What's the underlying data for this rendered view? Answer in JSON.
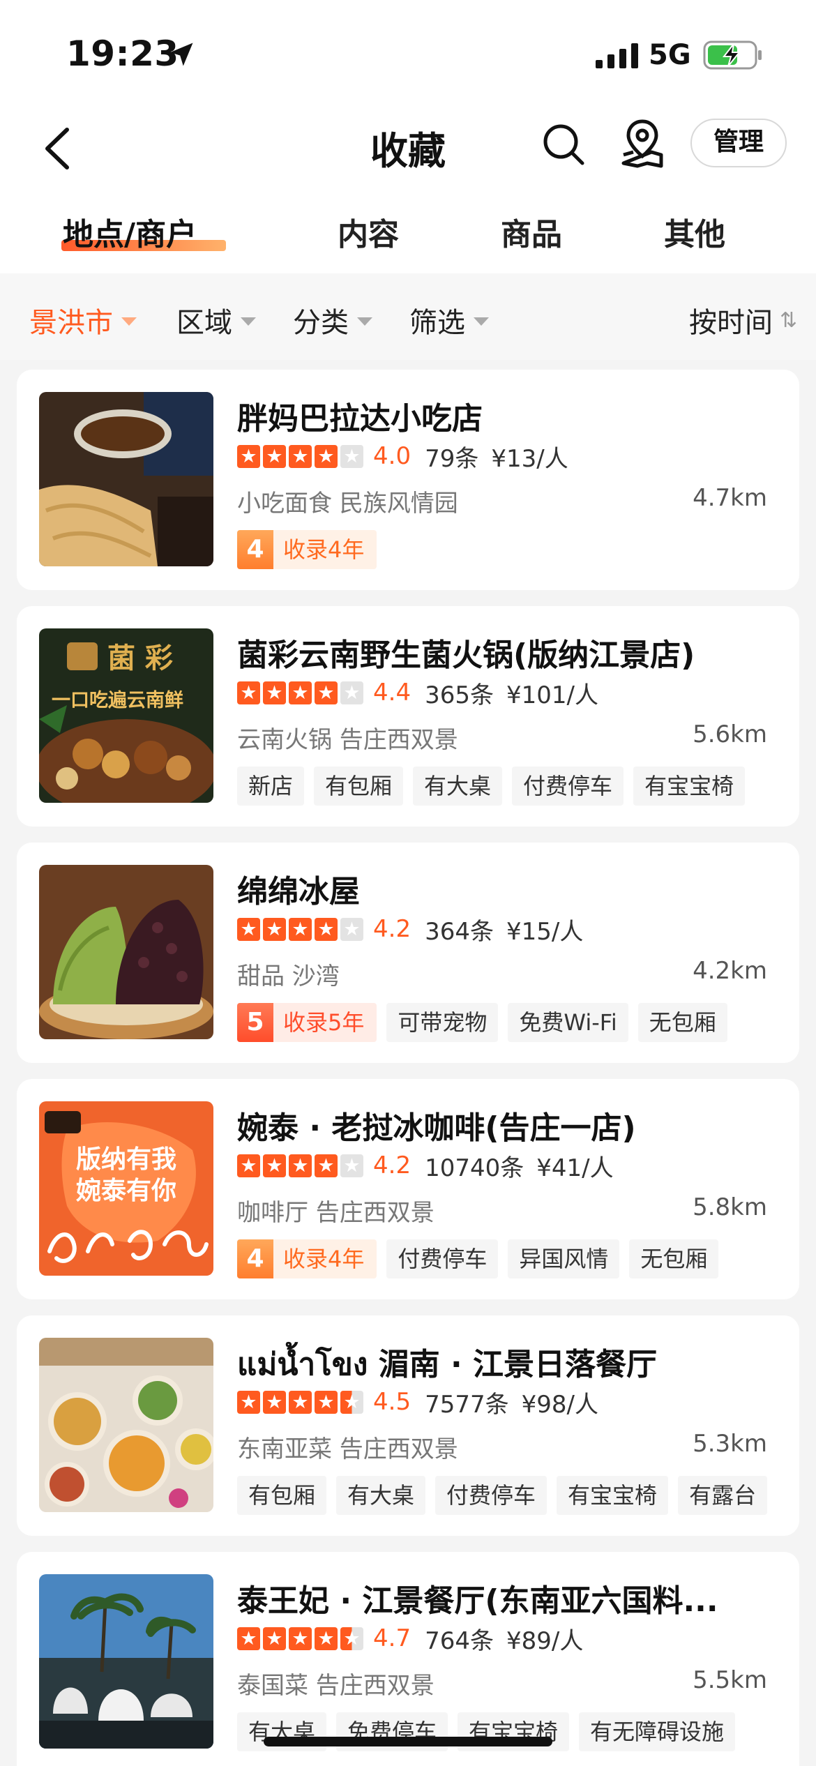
{
  "status": {
    "time": "19:23",
    "network": "5G"
  },
  "nav": {
    "title": "收藏",
    "manage": "管理"
  },
  "tabs": [
    "地点/商户",
    "内容",
    "商品",
    "其他"
  ],
  "filters": {
    "city": "景洪市",
    "area": "区域",
    "category": "分类",
    "filter": "筛选",
    "sort": "按时间"
  },
  "items": [
    {
      "name": "胖妈巴拉达小吃店",
      "stars": 4.0,
      "score": "4.0",
      "reviews": "79条",
      "price": "¥13/人",
      "meta": "小吃面食 民族风情园",
      "distance": "4.7km",
      "record": {
        "num": "4",
        "text": "收录4年"
      },
      "tags": []
    },
    {
      "name": "菌彩云南野生菌火锅(版纳江景店)",
      "stars": 4.0,
      "score": "4.4",
      "reviews": "365条",
      "price": "¥101/人",
      "meta": "云南火锅 告庄西双景",
      "distance": "5.6km",
      "record": null,
      "tags": [
        "新店",
        "有包厢",
        "有大桌",
        "付费停车",
        "有宝宝椅"
      ],
      "thumb_text": {
        "brand": "菌 彩",
        "slogan": "一口吃遍云南鲜"
      }
    },
    {
      "name": "绵绵冰屋",
      "stars": 4.0,
      "score": "4.2",
      "reviews": "364条",
      "price": "¥15/人",
      "meta": "甜品 沙湾",
      "distance": "4.2km",
      "record": {
        "num": "5",
        "text": "收录5年"
      },
      "tags": [
        "可带宠物",
        "免费Wi-Fi",
        "无包厢"
      ]
    },
    {
      "name": "婉泰 · 老挝冰咖啡(告庄一店)",
      "stars": 4.0,
      "score": "4.2",
      "reviews": "10740条",
      "price": "¥41/人",
      "meta": "咖啡厅 告庄西双景",
      "distance": "5.8km",
      "record": {
        "num": "4",
        "text": "收录4年"
      },
      "tags": [
        "付费停车",
        "异国风情",
        "无包厢"
      ],
      "thumb_text": {
        "line1": "版纳有我",
        "line2": "婉泰有你"
      }
    },
    {
      "name": "แม่น้ำโขง 湄南 · 江景日落餐厅",
      "stars": 4.5,
      "score": "4.5",
      "reviews": "7577条",
      "price": "¥98/人",
      "meta": "东南亚菜 告庄西双景",
      "distance": "5.3km",
      "record": null,
      "tags": [
        "有包厢",
        "有大桌",
        "付费停车",
        "有宝宝椅",
        "有露台"
      ]
    },
    {
      "name": "泰王妃 · 江景餐厅(东南亚六国料...",
      "stars": 4.5,
      "score": "4.7",
      "reviews": "764条",
      "price": "¥89/人",
      "meta": "泰国菜 告庄西双景",
      "distance": "5.5km",
      "record": null,
      "tags": [
        "有大桌",
        "免费停车",
        "有宝宝椅",
        "有无障碍设施"
      ]
    }
  ],
  "colors": {
    "accent": "#ff5a1f",
    "record": "#ff7e2e"
  }
}
